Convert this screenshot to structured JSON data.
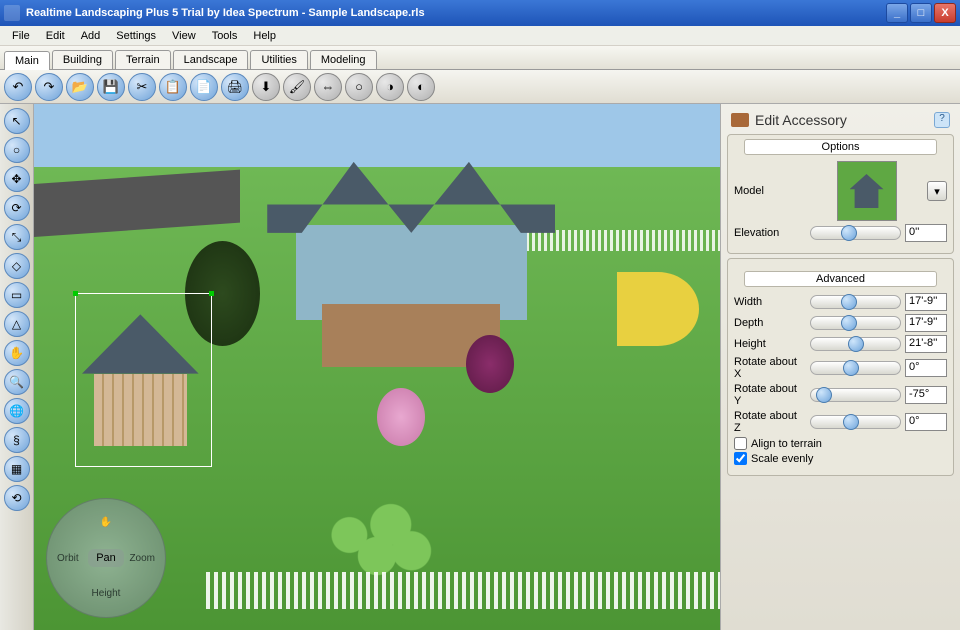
{
  "window": {
    "title": "Realtime Landscaping Plus 5 Trial by Idea Spectrum - Sample Landscape.rls",
    "min": "_",
    "max": "□",
    "close": "X"
  },
  "menu": [
    "File",
    "Edit",
    "Add",
    "Settings",
    "View",
    "Tools",
    "Help"
  ],
  "tabs": [
    "Main",
    "Building",
    "Terrain",
    "Landscape",
    "Utilities",
    "Modeling"
  ],
  "active_tab": "Main",
  "nav": {
    "orbit": "Orbit",
    "zoom": "Zoom",
    "pan": "Pan",
    "height": "Height"
  },
  "panel": {
    "title": "Edit Accessory",
    "help": "?",
    "options_title": "Options",
    "model_label": "Model",
    "elevation_label": "Elevation",
    "elevation_value": "0''",
    "advanced_title": "Advanced",
    "width_label": "Width",
    "width_value": "17'-9''",
    "depth_label": "Depth",
    "depth_value": "17'-9''",
    "height_label": "Height",
    "height_value": "21'-8''",
    "rotx_label": "Rotate about X",
    "rotx_value": "0°",
    "roty_label": "Rotate about Y",
    "roty_value": "-75°",
    "rotz_label": "Rotate about Z",
    "rotz_value": "0°",
    "align_label": "Align to terrain",
    "align_checked": false,
    "scale_label": "Scale evenly",
    "scale_checked": true
  },
  "sliders": {
    "elevation": 34,
    "width": 34,
    "depth": 34,
    "height": 42,
    "rotx": 36,
    "roty": 6,
    "rotz": 36
  }
}
